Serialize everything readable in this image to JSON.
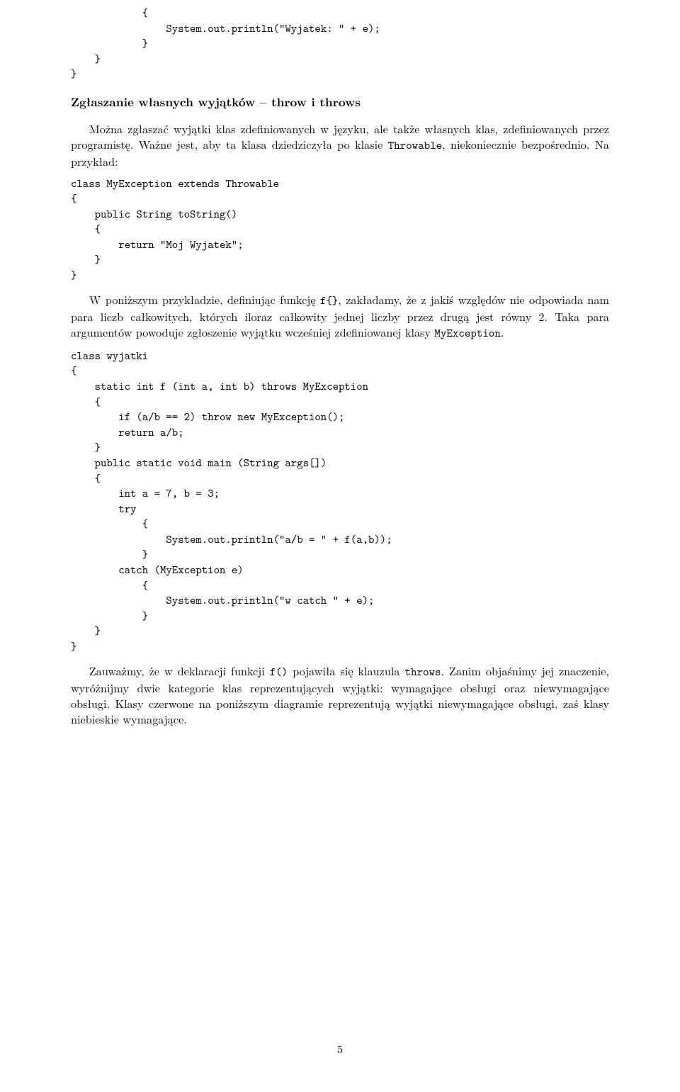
{
  "code1": "            {\n                System.out.println(\"Wyjatek: \" + e);\n            }\n    }\n}",
  "heading1": "Zgłaszanie własnych wyjątków – throw i throws",
  "para1_a": "Można zgłaszać wyjątki klas zdefiniowanych w języku, ale także własnych klas, zdefiniowanych przez programistę. Ważne jest, aby ta klasa dziedziczyła po klasie ",
  "para1_mono": "Throwable",
  "para1_b": ", niekoniecznie bezpośrednio. Na przykład:",
  "code2": "class MyException extends Throwable\n{\n    public String toString()\n    {\n        return \"Moj Wyjatek\";\n    }\n}",
  "para2_a": "W poniższym przykładzie, definiując funkcję ",
  "para2_mono1": "f{}",
  "para2_b": ", zakładamy, że z jakiś względów nie odpowiada nam para liczb całkowitych, których iloraz całkowity jednej liczby przez drugą jest równy 2. Taka para argumentów powoduje zgłoszenie wyjątku wcześniej zdefiniowanej klasy ",
  "para2_mono2": "MyException",
  "para2_c": ".",
  "code3": "class wyjatki\n{\n    static int f (int a, int b) throws MyException\n    {\n        if (a/b == 2) throw new MyException();\n        return a/b;\n    }\n    public static void main (String args[])\n    {\n        int a = 7, b = 3;\n        try\n            {\n                System.out.println(\"a/b = \" + f(a,b));\n            }\n        catch (MyException e)\n            {\n                System.out.println(\"w catch \" + e);\n            }\n    }\n}",
  "para3_a": "Zauważmy, że w deklaracji funkcji ",
  "para3_mono1": "f()",
  "para3_b": " pojawiła się klauzula ",
  "para3_mono2": "throws",
  "para3_c": ". Zanim objaśnimy jej znaczenie, wyróżnijmy dwie kategorie klas reprezentujących wyjątki: wymagające obsługi oraz niewymagające obsługi. Klasy czerwone na poniższym diagramie reprezentują wyjątki niewymagające obsługi, zaś klasy niebieskie wymagające.",
  "pagenum": "5"
}
